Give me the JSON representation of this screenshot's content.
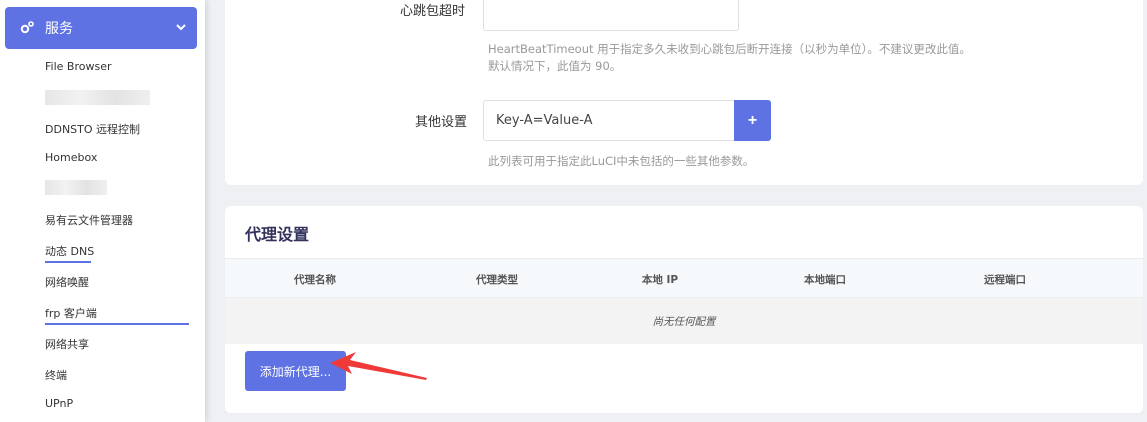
{
  "sidebar": {
    "section_title": "服务",
    "items": [
      {
        "label": "File Browser"
      },
      {
        "label": "DDNSTO 远程控制"
      },
      {
        "label": "Homebox"
      },
      {
        "label": "易有云文件管理器"
      },
      {
        "label": "动态 DNS"
      },
      {
        "label": "网络唤醒"
      },
      {
        "label": "frp 客户端"
      },
      {
        "label": "网络共享"
      },
      {
        "label": "终端"
      },
      {
        "label": "UPnP"
      }
    ]
  },
  "settings": {
    "heartbeat_label": "心跳包超时",
    "heartbeat_value": "",
    "heartbeat_help_line1": "HeartBeatTimeout 用于指定多久未收到心跳包后断开连接（以秒为单位）。不建议更改此值。",
    "heartbeat_help_line2": "默认情况下，此值为 90。",
    "other_label": "其他设置",
    "other_value": "Key-A=Value-A",
    "other_add": "+",
    "other_help": "此列表可用于指定此LuCI中未包括的一些其他参数。"
  },
  "proxy": {
    "title": "代理设置",
    "columns": [
      "代理名称",
      "代理类型",
      "本地 IP",
      "本地端口",
      "远程端口"
    ],
    "empty_text": "尚无任何配置",
    "add_button": "添加新代理..."
  },
  "colors": {
    "accent": "#5e72e4",
    "annotation_arrow": "#f03a3a"
  }
}
